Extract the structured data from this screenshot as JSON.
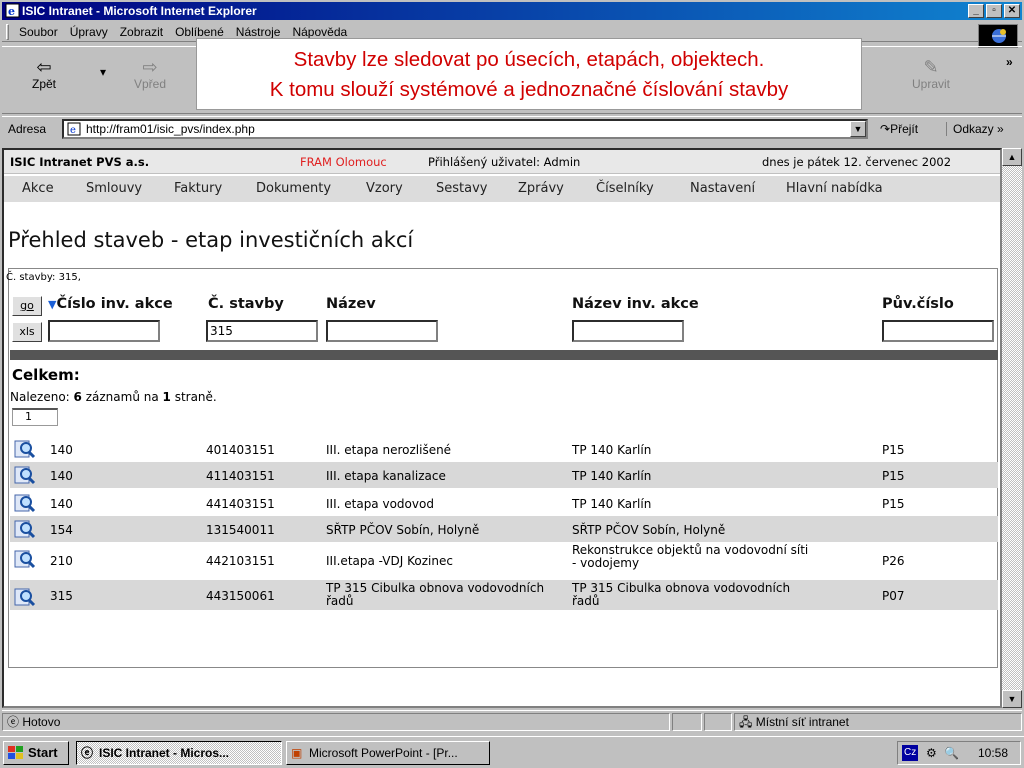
{
  "window": {
    "title": "ISIC Intranet - Microsoft Internet Explorer"
  },
  "menu": [
    "Soubor",
    "Úpravy",
    "Zobrazit",
    "Oblíbené",
    "Nástroje",
    "Nápověda"
  ],
  "toolbar": {
    "back": "Zpět",
    "forward": "Vpřed",
    "edit": "Upravit"
  },
  "address": {
    "label": "Adresa",
    "url": "http://fram01/isic_pvs/index.php",
    "go": "Přejít",
    "links": "Odkazy"
  },
  "callout": {
    "line1": "Stavby lze sledovat po úsecích, etapách, objektech.",
    "line2": "K tomu slouží systémové a jednoznačné číslování stavby"
  },
  "page": {
    "company": "ISIC Intranet PVS a.s.",
    "location": "FRAM Olomouc",
    "user": "Přihlášený uživatel: Admin",
    "date": "dnes je pátek 12. červenec 2002",
    "nav": [
      "Akce",
      "Smlouvy",
      "Faktury",
      "Dokumenty",
      "Vzory",
      "Sestavy",
      "Zprávy",
      "Číselníky",
      "Nastavení",
      "Hlavní nabídka"
    ],
    "title": "Přehled staveb - etap investičních akcí",
    "filter_summary": "Č. stavby: 315,",
    "go_label": "go",
    "xls_label": "xls",
    "columns": [
      "Číslo inv. akce",
      "Č. stavby",
      "Název",
      "Název inv. akce",
      "Pův.číslo"
    ],
    "filters": {
      "inv": "",
      "stavba": "315",
      "nazev": "",
      "nazev_akce": "",
      "puv": ""
    },
    "total_label": "Celkem:",
    "found_prefix": "Nalezeno: ",
    "found_count": "6",
    "found_mid": " záznamů na ",
    "found_pages": "1",
    "found_suffix": " straně.",
    "page_no": "1",
    "rows": [
      {
        "inv": "140",
        "stavba": "401403151",
        "nazev": "III. etapa nerozlišené",
        "akce": "TP 140 Karlín",
        "puv": "P15"
      },
      {
        "inv": "140",
        "stavba": "411403151",
        "nazev": "III. etapa kanalizace",
        "akce": "TP 140 Karlín",
        "puv": "P15"
      },
      {
        "inv": "140",
        "stavba": "441403151",
        "nazev": "III. etapa vodovod",
        "akce": "TP 140 Karlín",
        "puv": "P15"
      },
      {
        "inv": "154",
        "stavba": "131540011",
        "nazev": "SŘTP PČOV Sobín, Holyně",
        "akce": "SŘTP PČOV Sobín, Holyně",
        "puv": ""
      },
      {
        "inv": "210",
        "stavba": "442103151",
        "nazev": "III.etapa -VDJ Kozinec",
        "akce": "Rekonstrukce objektů na vodovodní síti - vodojemy",
        "puv": "P26"
      },
      {
        "inv": "315",
        "stavba": "443150061",
        "nazev": "TP 315 Cibulka obnova vodovodních řadů",
        "akce": "TP 315 Cibulka obnova vodovodních řadů",
        "puv": "P07"
      }
    ]
  },
  "status": {
    "text": "Hotovo",
    "zone": "Místní síť intranet"
  },
  "taskbar": {
    "start": "Start",
    "tasks": [
      "ISIC Intranet - Micros...",
      "Microsoft PowerPoint - [Pr..."
    ],
    "lang": "Cz",
    "clock": "10:58"
  },
  "colors": {
    "accent_red": "#d00000",
    "title_blue": "#000080",
    "nav_gray": "#dcdcdc"
  }
}
